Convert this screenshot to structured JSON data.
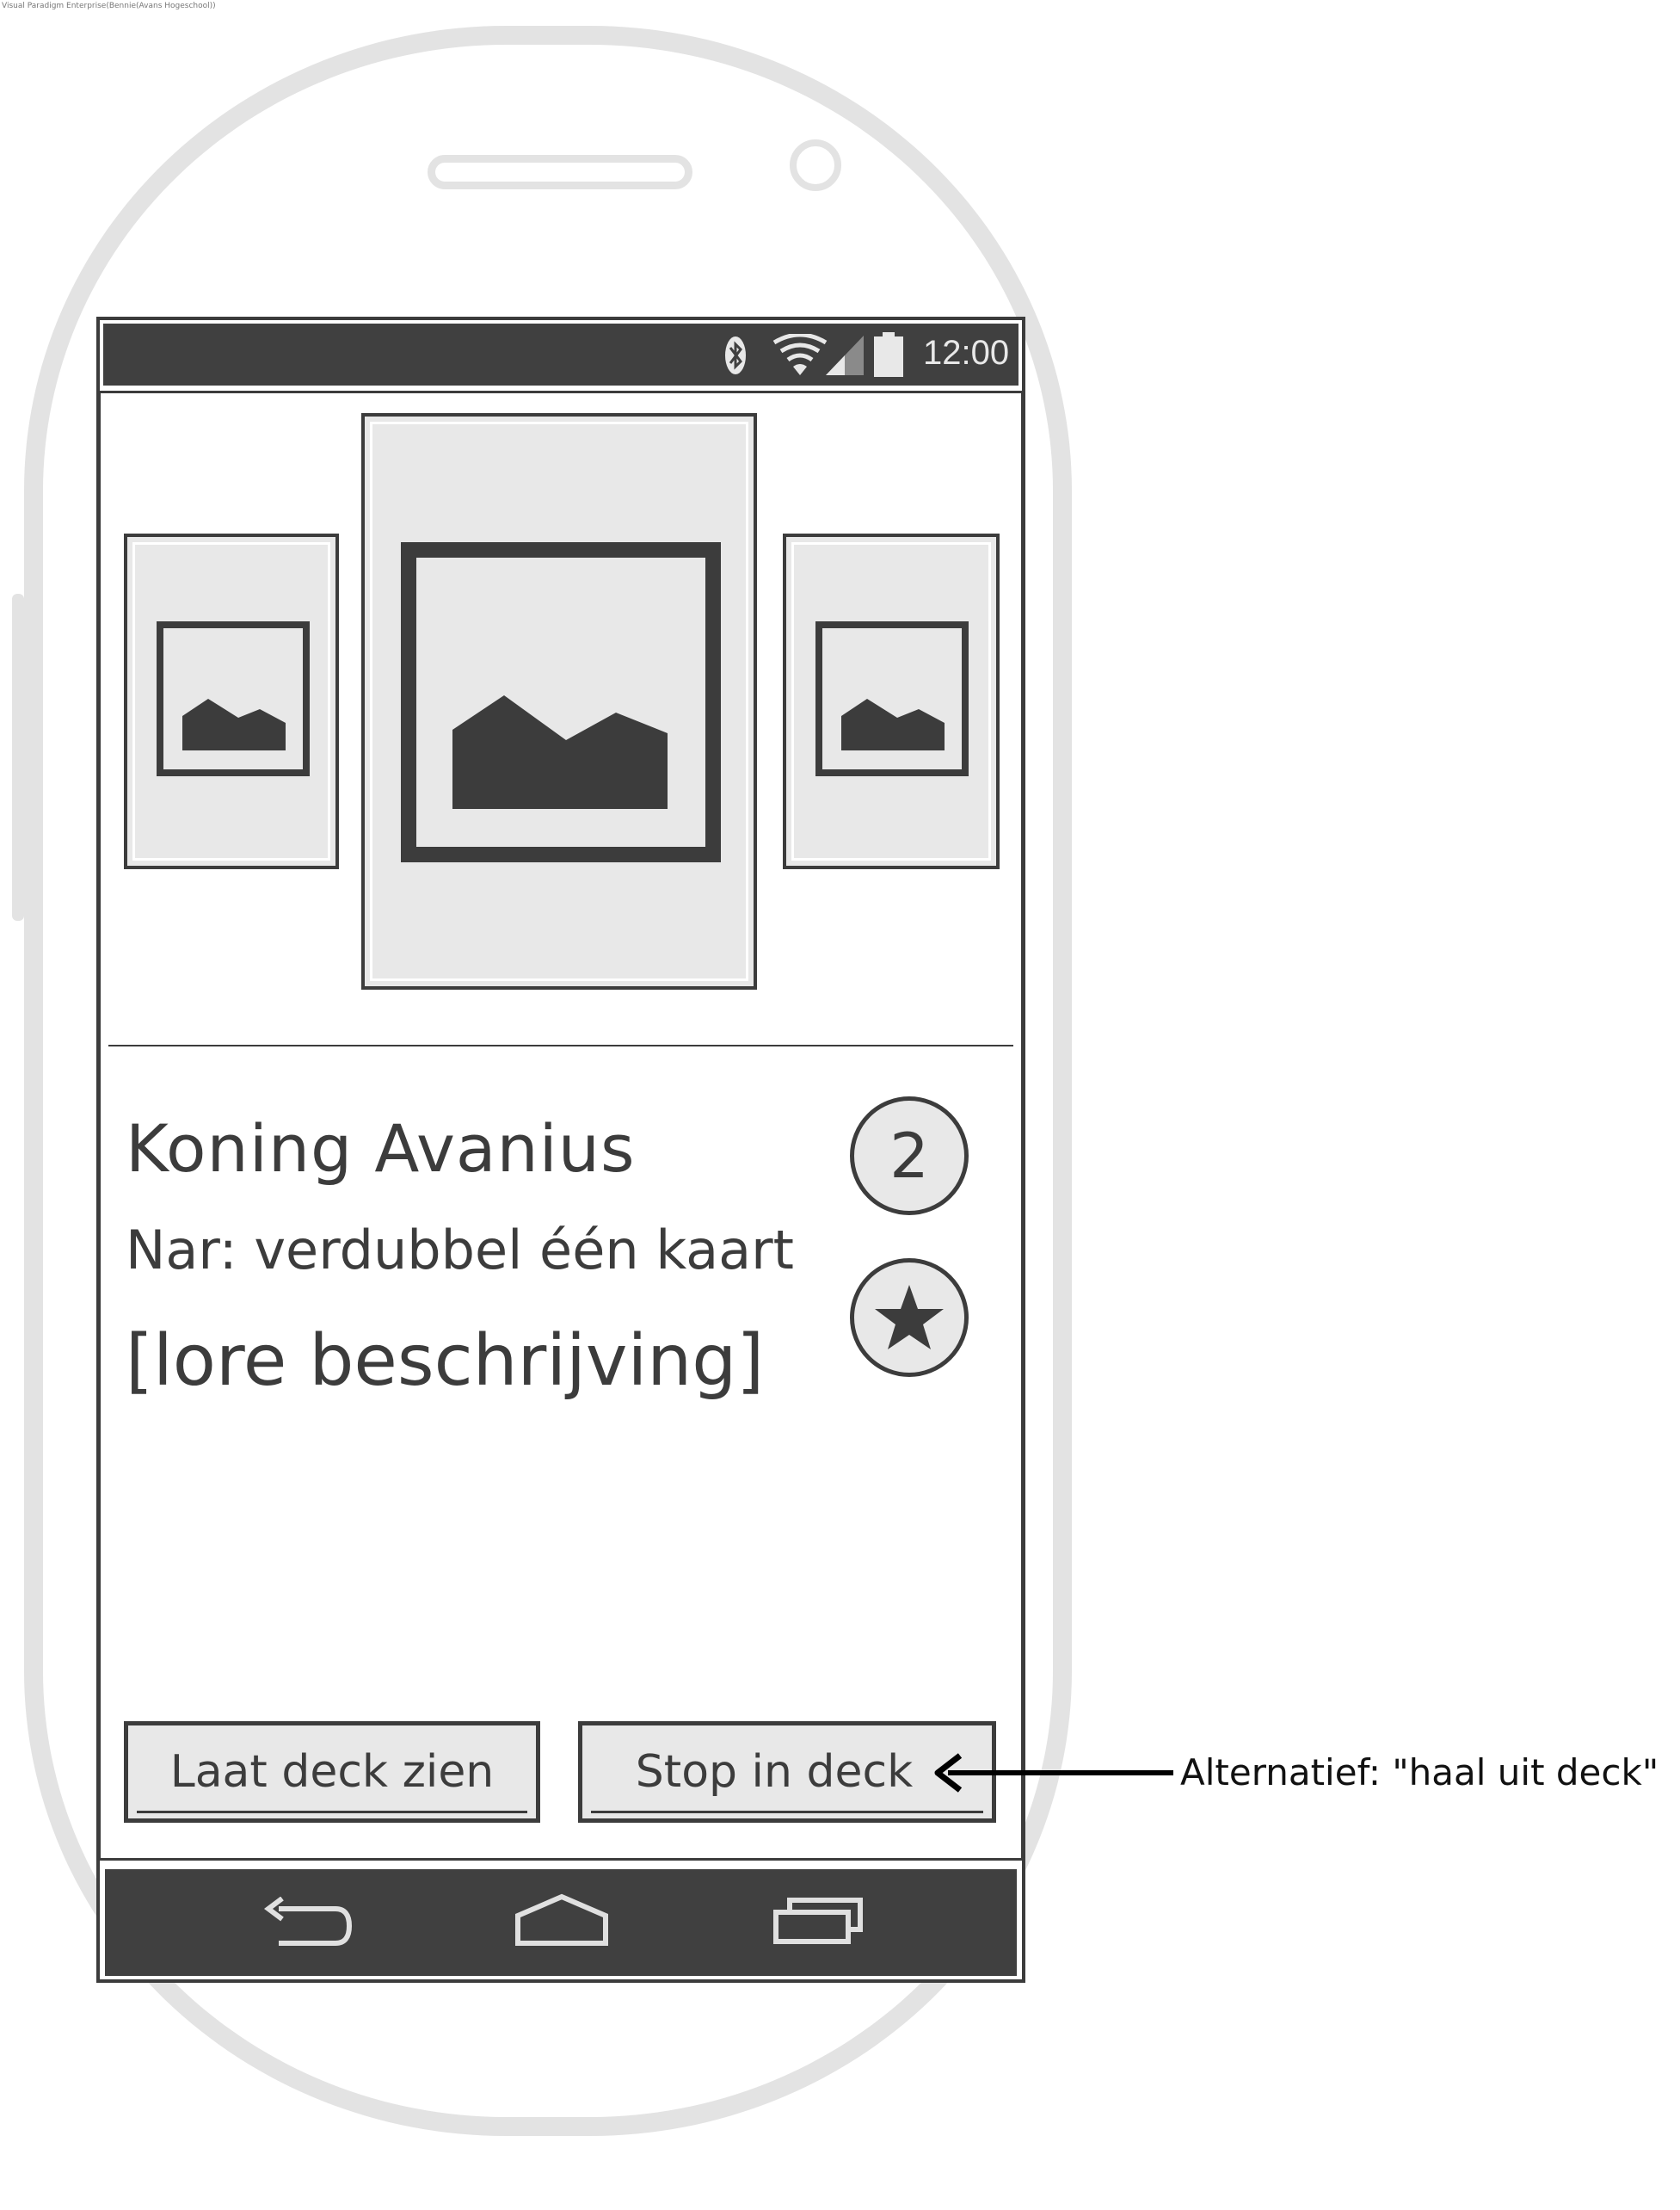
{
  "watermark": "Visual Paradigm Enterprise(Bennie(Avans Hogeschool))",
  "status_bar": {
    "time": "12:00",
    "icons": [
      "bluetooth-icon",
      "wifi-icon",
      "signal-icon",
      "battery-icon"
    ]
  },
  "carousel": {
    "items": [
      "image-placeholder-icon",
      "image-placeholder-icon",
      "image-placeholder-icon"
    ]
  },
  "card": {
    "title": "Koning Avanius",
    "ability": "Nar: verdubbel één kaart",
    "lore": "[lore beschrijving]",
    "count": "2",
    "favorite_icon": "star-icon"
  },
  "actions": {
    "show_deck_label": "Laat deck zien",
    "add_to_deck_label": "Stop in deck"
  },
  "nav_bar": {
    "icons": [
      "back-icon",
      "home-icon",
      "recent-apps-icon"
    ]
  },
  "annotation": {
    "text": "Alternatief: \"haal uit deck\""
  },
  "colors": {
    "dark": "#404040",
    "outline": "#3c3c3c",
    "fill": "#e8e8e8",
    "shell": "#e3e3e3"
  }
}
